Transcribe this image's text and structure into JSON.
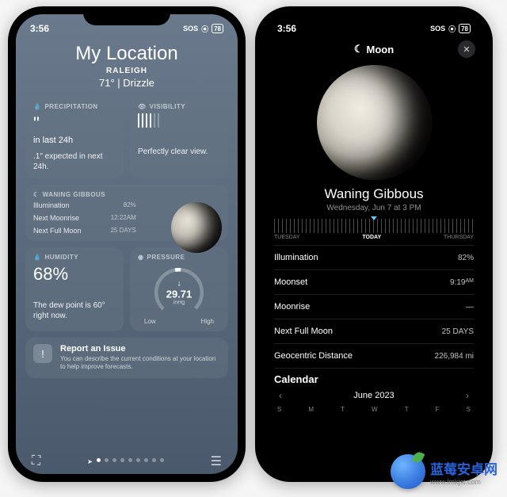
{
  "status": {
    "time": "3:56",
    "loc": "◀",
    "sos": "SOS",
    "wifi": "◉",
    "battery": "78"
  },
  "weather": {
    "title": "My Location",
    "city": "RALEIGH",
    "temp": "71°  |  Drizzle",
    "precip": {
      "header": "PRECIPITATION",
      "icon": "💧",
      "value": "\"",
      "period": "in last 24h",
      "note": ".1\" expected in next 24h."
    },
    "visibility": {
      "header": "VISIBILITY",
      "icon": "👁",
      "note": "Perfectly clear view."
    },
    "moon": {
      "header": "WANING GIBBOUS",
      "icon": "☾",
      "rows": [
        {
          "label": "Illumination",
          "val": "82%"
        },
        {
          "label": "Next Moonrise",
          "val": "12:22AM"
        },
        {
          "label": "Next Full Moon",
          "val": "25 DAYS"
        }
      ]
    },
    "humidity": {
      "header": "HUMIDITY",
      "icon": "💧",
      "value": "68%",
      "note": "The dew point is 60° right now."
    },
    "pressure": {
      "header": "PRESSURE",
      "icon": "◉",
      "value": "29.71",
      "unit": "inHg",
      "low": "Low",
      "high": "High"
    },
    "report": {
      "title": "Report an Issue",
      "text": "You can describe the current conditions at your location to help improve forecasts."
    }
  },
  "moonDetail": {
    "header": "Moon",
    "phase": "Waning Gibbous",
    "date": "Wednesday, Jun 7 at 3 PM",
    "timeline": {
      "prev": "TUESDAY",
      "today": "TODAY",
      "next": "THURSDAY"
    },
    "rows": [
      {
        "label": "Illumination",
        "val": "82%"
      },
      {
        "label": "Moonset",
        "val": "9:19",
        "suffix": "AM"
      },
      {
        "label": "Moonrise",
        "val": "—"
      },
      {
        "label": "Next Full Moon",
        "val": "25 DAYS"
      },
      {
        "label": "Geocentric Distance",
        "val": "226,984 mi"
      }
    ],
    "calendar": {
      "title": "Calendar",
      "month": "June 2023",
      "days": [
        "S",
        "M",
        "T",
        "W",
        "T",
        "F",
        "S"
      ]
    }
  },
  "watermark": {
    "name": "蓝莓安卓网",
    "url": "www.lmkjst.com"
  }
}
